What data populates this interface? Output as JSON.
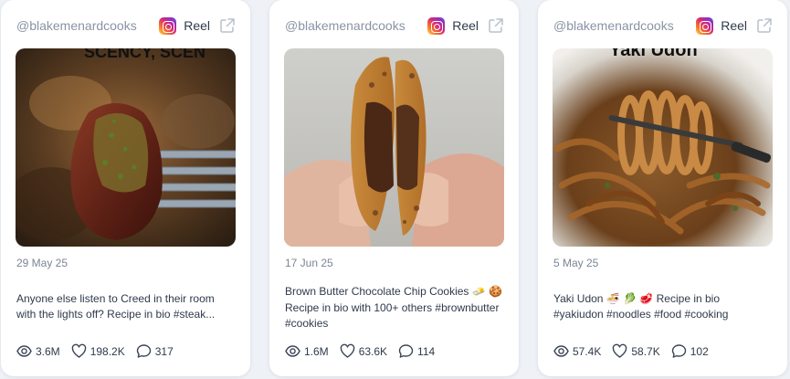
{
  "cards": [
    {
      "handle": "@blakemenardcooks",
      "platform": "Reel",
      "thumb_text": "SCENCY, SCEN",
      "date": "29 May 25",
      "caption": "Anyone else listen to Creed in their room with the lights off? Recipe in bio #steak...",
      "views": "3.6M",
      "likes": "198.2K",
      "comments": "317"
    },
    {
      "handle": "@blakemenardcooks",
      "platform": "Reel",
      "date": "17 Jun 25",
      "caption": "Brown Butter Chocolate Chip Cookies 🧈 🍪 Recipe in bio with 100+ others #brownbutter #cookies",
      "views": "1.6M",
      "likes": "63.6K",
      "comments": "114"
    },
    {
      "handle": "@blakemenardcooks",
      "platform": "Reel",
      "thumb_text": "Yaki Udon",
      "date": "5 May 25",
      "caption": "Yaki Udon 🍜 🥬 🥩 Recipe in bio #yakiudon #noodles #food #cooking",
      "views": "57.4K",
      "likes": "58.7K",
      "comments": "102"
    }
  ],
  "colors": {
    "page_bg": "#eef1f6",
    "card_bg": "#ffffff",
    "muted_text": "#8a93a5",
    "body_text": "#2f3a4c"
  },
  "icons": [
    "instagram-icon",
    "external-link-icon",
    "eye-icon",
    "heart-icon",
    "comment-icon"
  ]
}
